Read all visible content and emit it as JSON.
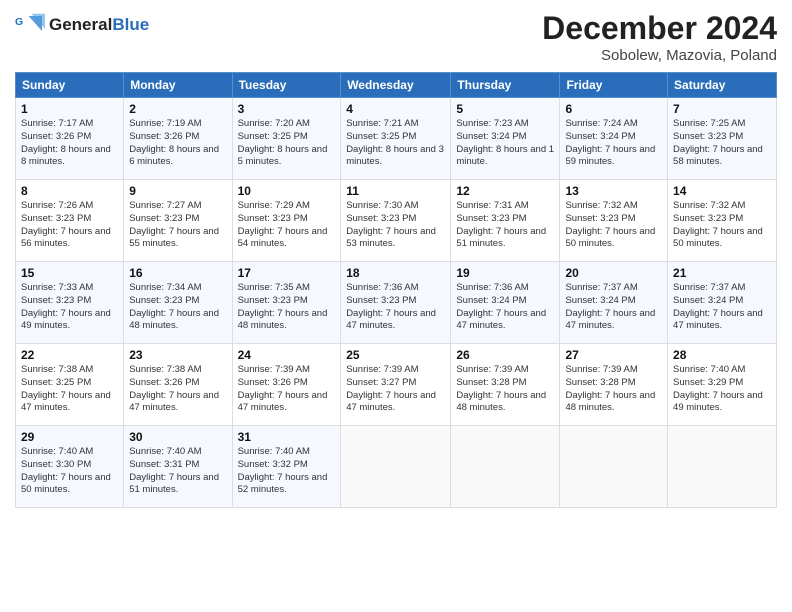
{
  "header": {
    "title": "December 2024",
    "subtitle": "Sobolew, Mazovia, Poland"
  },
  "days": [
    "Sunday",
    "Monday",
    "Tuesday",
    "Wednesday",
    "Thursday",
    "Friday",
    "Saturday"
  ],
  "weeks": [
    [
      {
        "day": "1",
        "sunrise": "Sunrise: 7:17 AM",
        "sunset": "Sunset: 3:26 PM",
        "daylight": "Daylight: 8 hours and 8 minutes."
      },
      {
        "day": "2",
        "sunrise": "Sunrise: 7:19 AM",
        "sunset": "Sunset: 3:26 PM",
        "daylight": "Daylight: 8 hours and 6 minutes."
      },
      {
        "day": "3",
        "sunrise": "Sunrise: 7:20 AM",
        "sunset": "Sunset: 3:25 PM",
        "daylight": "Daylight: 8 hours and 5 minutes."
      },
      {
        "day": "4",
        "sunrise": "Sunrise: 7:21 AM",
        "sunset": "Sunset: 3:25 PM",
        "daylight": "Daylight: 8 hours and 3 minutes."
      },
      {
        "day": "5",
        "sunrise": "Sunrise: 7:23 AM",
        "sunset": "Sunset: 3:24 PM",
        "daylight": "Daylight: 8 hours and 1 minute."
      },
      {
        "day": "6",
        "sunrise": "Sunrise: 7:24 AM",
        "sunset": "Sunset: 3:24 PM",
        "daylight": "Daylight: 7 hours and 59 minutes."
      },
      {
        "day": "7",
        "sunrise": "Sunrise: 7:25 AM",
        "sunset": "Sunset: 3:23 PM",
        "daylight": "Daylight: 7 hours and 58 minutes."
      }
    ],
    [
      {
        "day": "8",
        "sunrise": "Sunrise: 7:26 AM",
        "sunset": "Sunset: 3:23 PM",
        "daylight": "Daylight: 7 hours and 56 minutes."
      },
      {
        "day": "9",
        "sunrise": "Sunrise: 7:27 AM",
        "sunset": "Sunset: 3:23 PM",
        "daylight": "Daylight: 7 hours and 55 minutes."
      },
      {
        "day": "10",
        "sunrise": "Sunrise: 7:29 AM",
        "sunset": "Sunset: 3:23 PM",
        "daylight": "Daylight: 7 hours and 54 minutes."
      },
      {
        "day": "11",
        "sunrise": "Sunrise: 7:30 AM",
        "sunset": "Sunset: 3:23 PM",
        "daylight": "Daylight: 7 hours and 53 minutes."
      },
      {
        "day": "12",
        "sunrise": "Sunrise: 7:31 AM",
        "sunset": "Sunset: 3:23 PM",
        "daylight": "Daylight: 7 hours and 51 minutes."
      },
      {
        "day": "13",
        "sunrise": "Sunrise: 7:32 AM",
        "sunset": "Sunset: 3:23 PM",
        "daylight": "Daylight: 7 hours and 50 minutes."
      },
      {
        "day": "14",
        "sunrise": "Sunrise: 7:32 AM",
        "sunset": "Sunset: 3:23 PM",
        "daylight": "Daylight: 7 hours and 50 minutes."
      }
    ],
    [
      {
        "day": "15",
        "sunrise": "Sunrise: 7:33 AM",
        "sunset": "Sunset: 3:23 PM",
        "daylight": "Daylight: 7 hours and 49 minutes."
      },
      {
        "day": "16",
        "sunrise": "Sunrise: 7:34 AM",
        "sunset": "Sunset: 3:23 PM",
        "daylight": "Daylight: 7 hours and 48 minutes."
      },
      {
        "day": "17",
        "sunrise": "Sunrise: 7:35 AM",
        "sunset": "Sunset: 3:23 PM",
        "daylight": "Daylight: 7 hours and 48 minutes."
      },
      {
        "day": "18",
        "sunrise": "Sunrise: 7:36 AM",
        "sunset": "Sunset: 3:23 PM",
        "daylight": "Daylight: 7 hours and 47 minutes."
      },
      {
        "day": "19",
        "sunrise": "Sunrise: 7:36 AM",
        "sunset": "Sunset: 3:24 PM",
        "daylight": "Daylight: 7 hours and 47 minutes."
      },
      {
        "day": "20",
        "sunrise": "Sunrise: 7:37 AM",
        "sunset": "Sunset: 3:24 PM",
        "daylight": "Daylight: 7 hours and 47 minutes."
      },
      {
        "day": "21",
        "sunrise": "Sunrise: 7:37 AM",
        "sunset": "Sunset: 3:24 PM",
        "daylight": "Daylight: 7 hours and 47 minutes."
      }
    ],
    [
      {
        "day": "22",
        "sunrise": "Sunrise: 7:38 AM",
        "sunset": "Sunset: 3:25 PM",
        "daylight": "Daylight: 7 hours and 47 minutes."
      },
      {
        "day": "23",
        "sunrise": "Sunrise: 7:38 AM",
        "sunset": "Sunset: 3:26 PM",
        "daylight": "Daylight: 7 hours and 47 minutes."
      },
      {
        "day": "24",
        "sunrise": "Sunrise: 7:39 AM",
        "sunset": "Sunset: 3:26 PM",
        "daylight": "Daylight: 7 hours and 47 minutes."
      },
      {
        "day": "25",
        "sunrise": "Sunrise: 7:39 AM",
        "sunset": "Sunset: 3:27 PM",
        "daylight": "Daylight: 7 hours and 47 minutes."
      },
      {
        "day": "26",
        "sunrise": "Sunrise: 7:39 AM",
        "sunset": "Sunset: 3:28 PM",
        "daylight": "Daylight: 7 hours and 48 minutes."
      },
      {
        "day": "27",
        "sunrise": "Sunrise: 7:39 AM",
        "sunset": "Sunset: 3:28 PM",
        "daylight": "Daylight: 7 hours and 48 minutes."
      },
      {
        "day": "28",
        "sunrise": "Sunrise: 7:40 AM",
        "sunset": "Sunset: 3:29 PM",
        "daylight": "Daylight: 7 hours and 49 minutes."
      }
    ],
    [
      {
        "day": "29",
        "sunrise": "Sunrise: 7:40 AM",
        "sunset": "Sunset: 3:30 PM",
        "daylight": "Daylight: 7 hours and 50 minutes."
      },
      {
        "day": "30",
        "sunrise": "Sunrise: 7:40 AM",
        "sunset": "Sunset: 3:31 PM",
        "daylight": "Daylight: 7 hours and 51 minutes."
      },
      {
        "day": "31",
        "sunrise": "Sunrise: 7:40 AM",
        "sunset": "Sunset: 3:32 PM",
        "daylight": "Daylight: 7 hours and 52 minutes."
      },
      null,
      null,
      null,
      null
    ]
  ]
}
